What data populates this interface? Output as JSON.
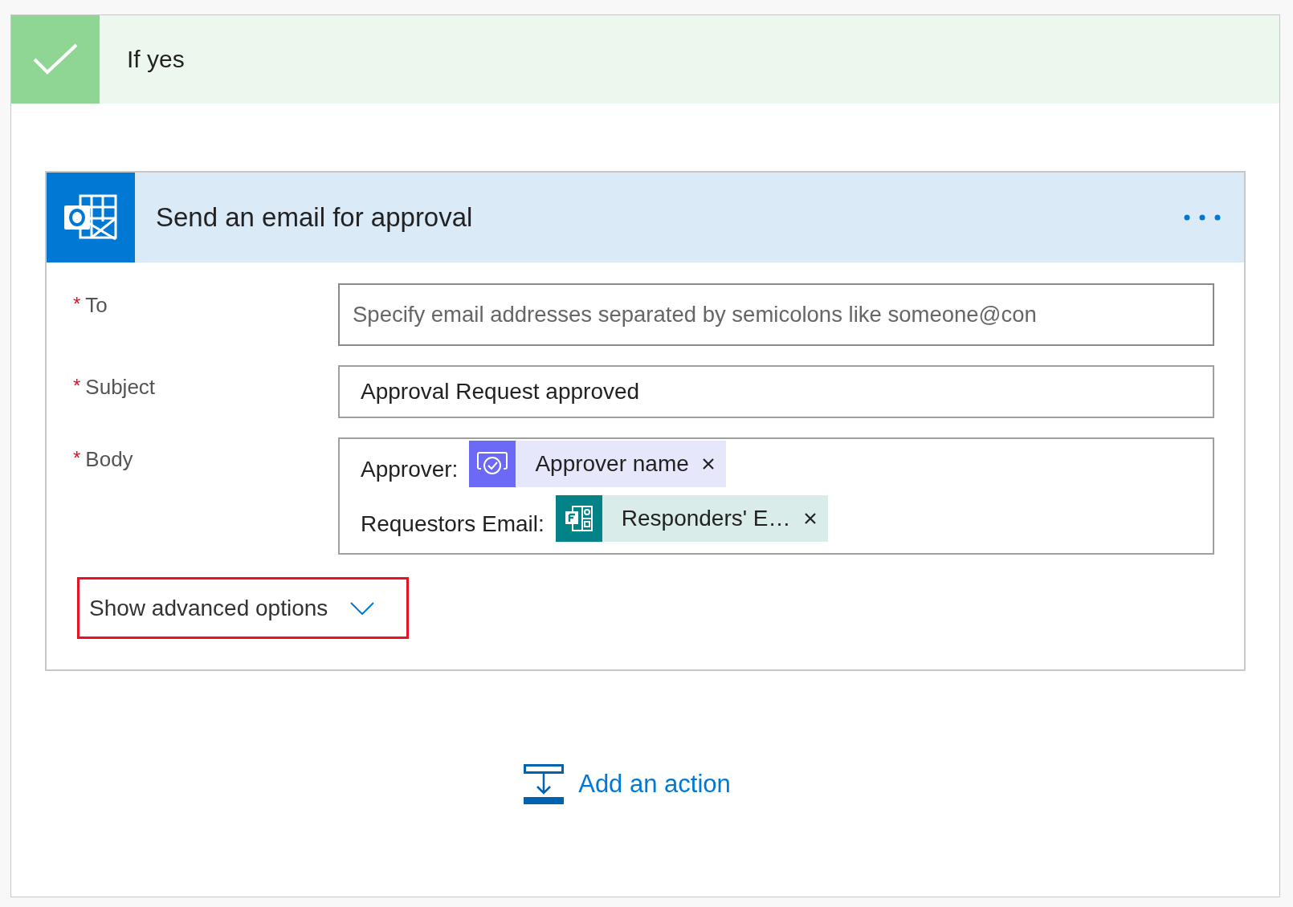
{
  "branch": {
    "title": "If yes"
  },
  "action": {
    "title": "Send an email for approval",
    "fields": [
      {
        "label": "To",
        "marker": "*",
        "kind": "input",
        "placeholder": "Specify email addresses separated by semicolons like someone@con"
      },
      {
        "label": "Subject",
        "marker": "*",
        "kind": "input",
        "value": "Approval Request approved"
      },
      {
        "label": "Body",
        "marker": "*",
        "kind": "rich",
        "lines": [
          {
            "text": "Approver:",
            "token": {
              "label": "Approver name",
              "kind": "approval"
            }
          },
          {
            "text": "Requestors Email:",
            "token": {
              "label": "Responders' E…",
              "kind": "forms"
            }
          }
        ]
      }
    ],
    "advanced": {
      "label": "Show advanced options",
      "highlighted": true
    }
  },
  "add_action": {
    "label": "Add an action"
  }
}
